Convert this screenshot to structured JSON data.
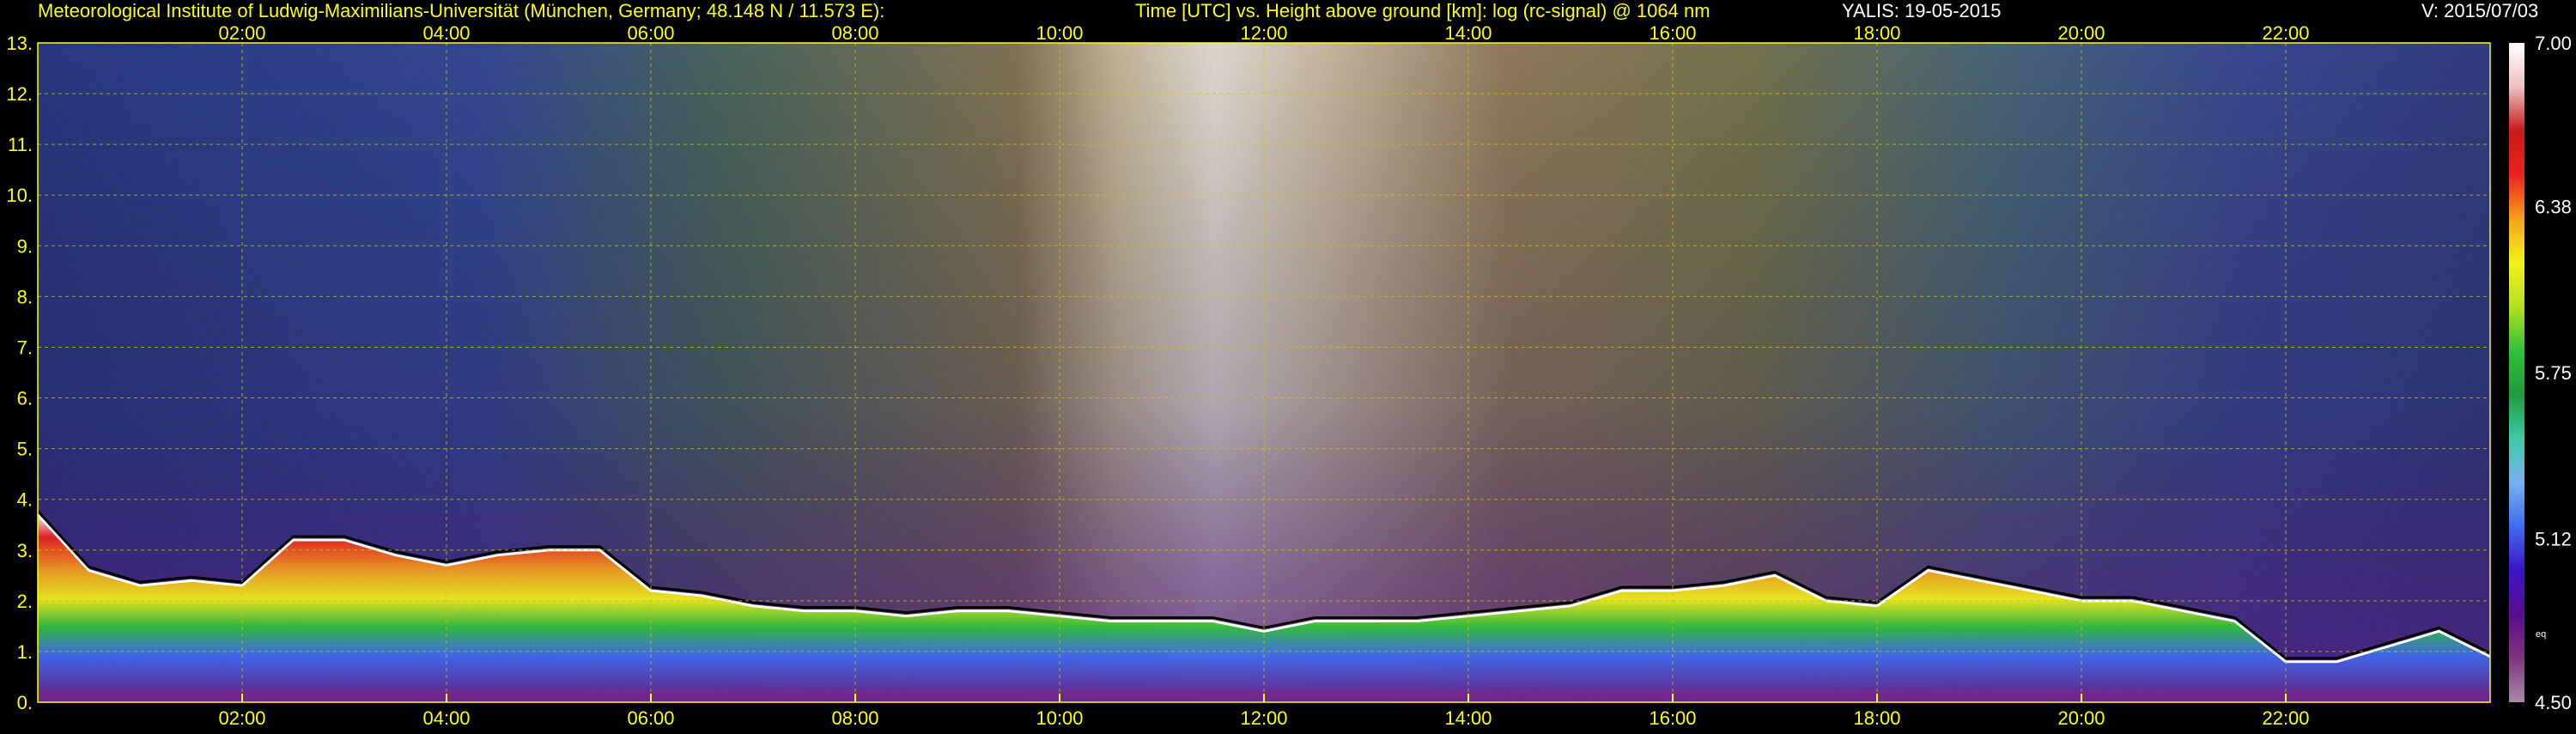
{
  "header": {
    "institute": "Meteorological Institute of Ludwig-Maximilians-Universität (München, Germany; 48.148 N / 11.573 E):",
    "description": "Time [UTC] vs. Height above ground [km]: log (rc-signal) @ 1064 nm",
    "station_date": "YALIS: 19-05-2015",
    "version": "V: 2015/07/03"
  },
  "colorbar": {
    "tick_labels": [
      "7.00",
      "6.38",
      "5.75",
      "5.12",
      "4.50"
    ],
    "tick_values": [
      7.0,
      6.38,
      5.75,
      5.12,
      4.5
    ],
    "small_label": "eq",
    "stops": [
      "#a98aa8",
      "#7e3580",
      "#5a0d8c",
      "#3a14c8",
      "#3f6cf0",
      "#7ab0ee",
      "#3ccba8",
      "#1f9a3a",
      "#2ec23a",
      "#b5df20",
      "#f2f21a",
      "#f5a21c",
      "#ee2020",
      "#c81a1a",
      "#eec0c0",
      "#ffffff"
    ]
  },
  "colors": {
    "text": "#ffff00",
    "grid": "#c8c800",
    "background": "#000000"
  },
  "chart_data": {
    "type": "heatmap",
    "title": "Time [UTC] vs. Height above ground [km]: log (rc-signal) @ 1064 nm",
    "x_axis": {
      "label": "Time [UTC]",
      "tick_labels": [
        "02:00",
        "04:00",
        "06:00",
        "08:00",
        "10:00",
        "12:00",
        "14:00",
        "16:00",
        "18:00",
        "20:00",
        "22:00"
      ],
      "tick_hours": [
        2,
        4,
        6,
        8,
        10,
        12,
        14,
        16,
        18,
        20,
        22
      ],
      "range_hours": [
        0,
        24
      ]
    },
    "y_axis": {
      "label": "Height above ground [km]",
      "tick_labels": [
        "0.",
        "1.",
        "2.",
        "3.",
        "4.",
        "5.",
        "6.",
        "7.",
        "8.",
        "9.",
        "10.",
        "11.",
        "12.",
        "13."
      ],
      "tick_values": [
        0,
        1,
        2,
        3,
        4,
        5,
        6,
        7,
        8,
        9,
        10,
        11,
        12,
        13
      ],
      "range_km": [
        0,
        13
      ]
    },
    "value_range": [
      4.5,
      7.0
    ],
    "grid": true,
    "boundary_layer_top_km": {
      "hours": [
        0.0,
        0.5,
        1.0,
        1.5,
        2.0,
        2.5,
        3.0,
        3.5,
        4.0,
        4.5,
        5.0,
        5.5,
        6.0,
        6.5,
        7.0,
        7.5,
        8.0,
        8.5,
        9.0,
        9.5,
        10.0,
        10.5,
        11.0,
        11.5,
        12.0,
        12.5,
        13.0,
        13.5,
        14.0,
        14.5,
        15.0,
        15.5,
        16.0,
        16.5,
        17.0,
        17.5,
        18.0,
        18.5,
        19.0,
        19.5,
        20.0,
        20.5,
        21.0,
        21.5,
        22.0,
        22.5,
        23.0,
        23.5,
        24.0
      ],
      "height": [
        3.7,
        2.6,
        2.3,
        2.4,
        2.3,
        3.2,
        3.2,
        2.9,
        2.7,
        2.9,
        3.0,
        3.0,
        2.2,
        2.1,
        1.9,
        1.8,
        1.8,
        1.7,
        1.8,
        1.8,
        1.7,
        1.6,
        1.6,
        1.6,
        1.4,
        1.6,
        1.6,
        1.6,
        1.7,
        1.8,
        1.9,
        2.2,
        2.2,
        2.3,
        2.5,
        2.0,
        1.9,
        2.6,
        2.4,
        2.2,
        2.0,
        2.0,
        1.8,
        1.6,
        0.8,
        0.8,
        1.1,
        1.4,
        0.9
      ]
    }
  }
}
